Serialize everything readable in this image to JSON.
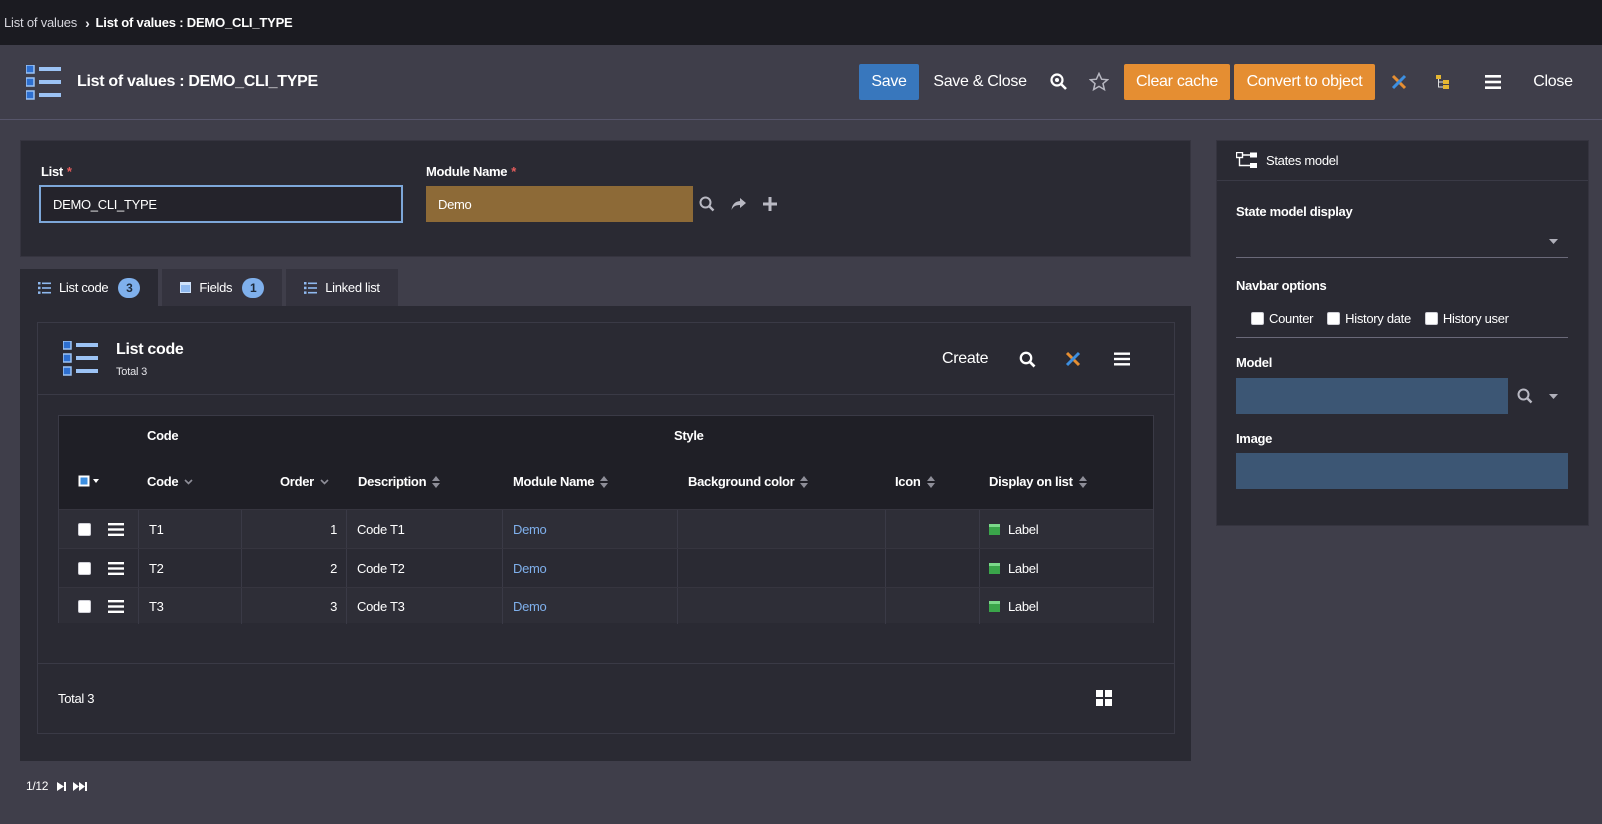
{
  "breadcrumb": {
    "parent": "List of values",
    "current": "List of values : DEMO_CLI_TYPE"
  },
  "header": {
    "title": "List of values : DEMO_CLI_TYPE",
    "save_label": "Save",
    "save_close_label": "Save & Close",
    "clear_cache_label": "Clear cache",
    "convert_label": "Convert to object",
    "close_label": "Close"
  },
  "form": {
    "list_label": "List",
    "list_value": "DEMO_CLI_TYPE",
    "module_label": "Module Name",
    "module_value": "Demo",
    "required_mark": "*"
  },
  "tabs": [
    {
      "label": "List code",
      "count": "3"
    },
    {
      "label": "Fields",
      "count": "1"
    },
    {
      "label": "Linked list"
    }
  ],
  "list_code": {
    "title": "List code",
    "subtitle": "Total 3",
    "create_label": "Create",
    "group_headers": {
      "code": "Code",
      "style": "Style"
    },
    "columns": [
      "Code",
      "Order",
      "Description",
      "Module Name",
      "Background color",
      "Icon",
      "Display on list"
    ],
    "rows": [
      {
        "code": "T1",
        "order": "1",
        "description": "Code T1",
        "module": "Demo",
        "background": "",
        "icon": "",
        "display": "Label"
      },
      {
        "code": "T2",
        "order": "2",
        "description": "Code T2",
        "module": "Demo",
        "background": "",
        "icon": "",
        "display": "Label"
      },
      {
        "code": "T3",
        "order": "3",
        "description": "Code T3",
        "module": "Demo",
        "background": "",
        "icon": "",
        "display": "Label"
      }
    ],
    "footer_total": "Total 3"
  },
  "pager": {
    "text": "1/12"
  },
  "states_model": {
    "title": "States model",
    "display_label": "State model display",
    "navbar_label": "Navbar options",
    "options": [
      "Counter",
      "History date",
      "History user"
    ],
    "model_label": "Model",
    "image_label": "Image"
  },
  "colors": {
    "accent_blue": "#3877bd",
    "orange": "#e58e32",
    "module_field": "#8d6a37",
    "link": "#7fb0ec"
  }
}
